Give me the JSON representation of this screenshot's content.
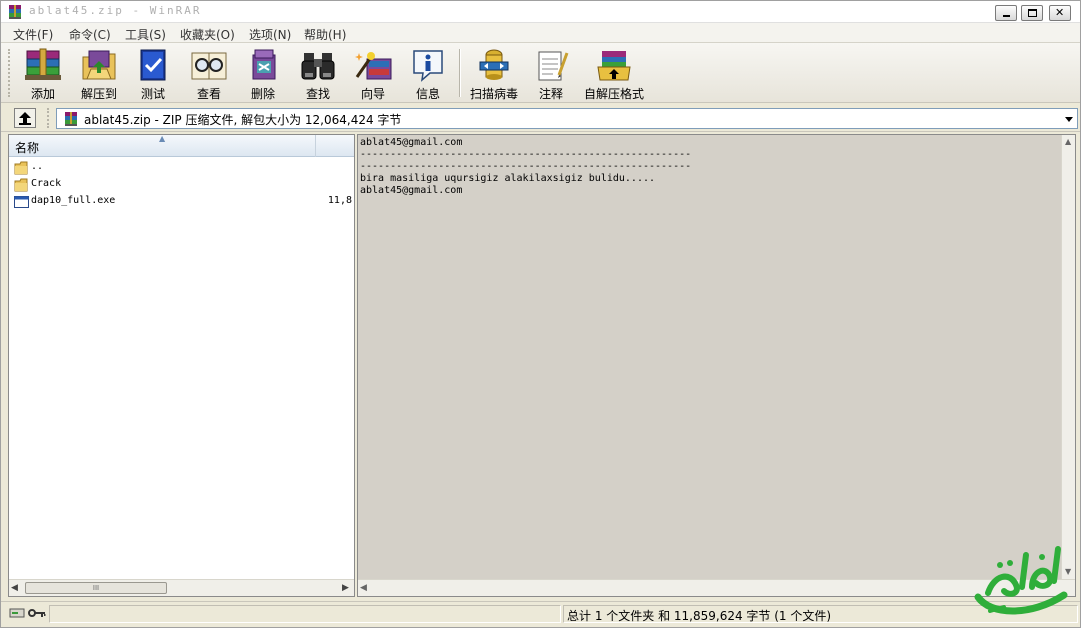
{
  "window": {
    "title": "ablat45.zip - WinRAR"
  },
  "menu": {
    "items": [
      "文件(F)",
      "命令(C)",
      "工具(S)",
      "收藏夹(O)",
      "选项(N)",
      "帮助(H)"
    ]
  },
  "toolbar": {
    "buttons": [
      {
        "label": "添加",
        "icon": "books-add-icon"
      },
      {
        "label": "解压到",
        "icon": "extract-folder-icon"
      },
      {
        "label": "测试",
        "icon": "test-book-icon"
      },
      {
        "label": "查看",
        "icon": "view-glasses-icon"
      },
      {
        "label": "删除",
        "icon": "delete-book-icon"
      },
      {
        "label": "查找",
        "icon": "binoculars-icon"
      },
      {
        "label": "向导",
        "icon": "wizard-icon"
      },
      {
        "label": "信息",
        "icon": "info-icon"
      },
      {
        "label": "扫描病毒",
        "icon": "virus-scan-icon"
      },
      {
        "label": "注释",
        "icon": "comment-notepad-icon"
      },
      {
        "label": "自解压格式",
        "icon": "sfx-box-icon"
      }
    ]
  },
  "addressbar": {
    "path": "ablat45.zip - ZIP 压缩文件, 解包大小为 12,064,424 字节"
  },
  "filelist": {
    "header": {
      "name": "名称"
    },
    "rows": [
      {
        "name": "..",
        "size": "",
        "icon": "folder-up-icon"
      },
      {
        "name": "Crack",
        "size": "",
        "icon": "folder-icon"
      },
      {
        "name": "dap10_full.exe",
        "size": "11,8",
        "icon": "exe-file-icon"
      }
    ],
    "scroll_thumb_glyph": "III"
  },
  "comment": {
    "lines": [
      "ablat45@gmail.com",
      "-------------------------------------------------------",
      "-------------------------------------------------------",
      "bira masiliga uqursigiz alakilaxsigiz bulidu.....",
      "ablat45@gmail.com"
    ]
  },
  "status": {
    "summary": "总计 1 个文件夹 和 11,859,624 字节 (1 个文件)"
  },
  "colors": {
    "window_bg": "#ece9d8",
    "comment_bg": "#d4d0c8",
    "header_blue": "#dde7f1",
    "watermark_green": "#2fae3a"
  }
}
